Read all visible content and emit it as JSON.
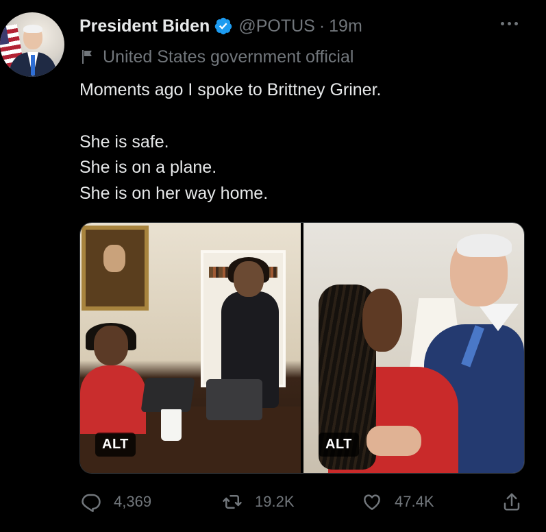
{
  "tweet": {
    "author_name": "President Biden",
    "handle": "@POTUS",
    "separator": "·",
    "time": "19m",
    "label": "United States government official",
    "text_line1": "Moments ago I spoke to Brittney Griner.",
    "text_line2": "She is safe.",
    "text_line3": "She is on a plane.",
    "text_line4": "She is on her way home."
  },
  "media": {
    "left_alt_badge": "ALT",
    "right_alt_badge": "ALT"
  },
  "actions": {
    "reply_count": "4,369",
    "retweet_count": "19.2K",
    "like_count": "47.4K"
  },
  "colors": {
    "background": "#000000",
    "primary_text": "#e7e9ea",
    "secondary_text": "#71767b",
    "verified_blue": "#1d9bf0"
  },
  "icons": [
    "verified-badge-icon",
    "government-flag-icon",
    "more-options-icon",
    "reply-icon",
    "retweet-icon",
    "like-icon",
    "share-icon"
  ]
}
